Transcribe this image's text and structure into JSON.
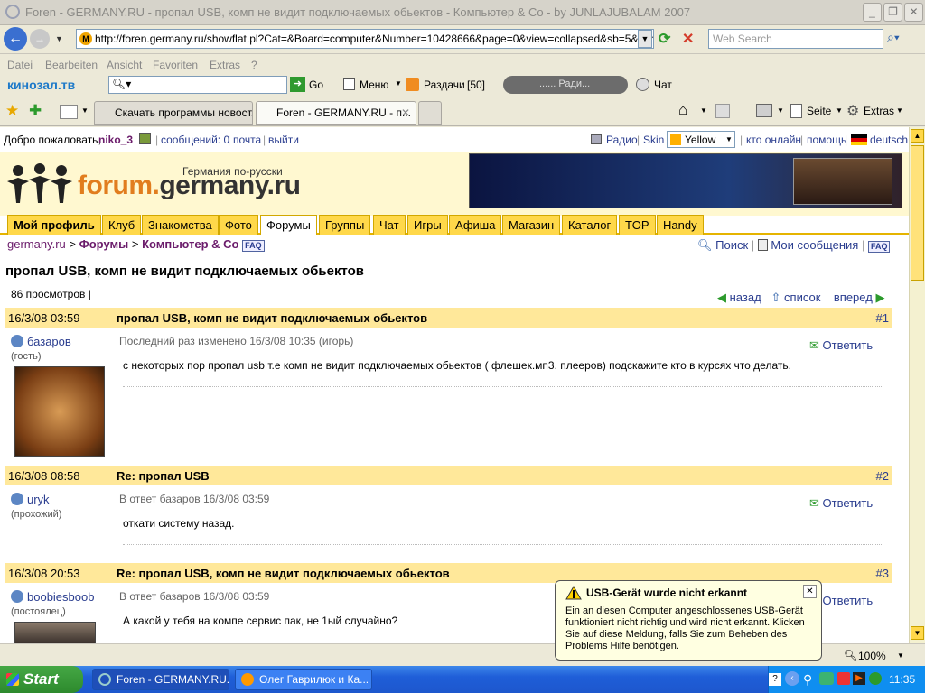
{
  "window": {
    "title": "Foren - GERMANY.RU - пропал USB, комп не видит подключаемых обьектов - Компьютер & Co - by JUNLAJUBALAM 2007"
  },
  "nav": {
    "address": "http://foren.germany.ru/showflat.pl?Cat=&Board=computer&Number=10428666&page=0&view=collapsed&sb=5&part=1&",
    "search_placeholder": "Web Search"
  },
  "menu": [
    "Datei",
    "Bearbeiten",
    "Ansicht",
    "Favoriten",
    "Extras",
    "?"
  ],
  "linkbar": {
    "brand": "кинозал.тв",
    "go": "Go",
    "menu": "Меню",
    "razdachi": "Раздачи",
    "razdachi_count": "[50]",
    "radio": "...... Ради...",
    "chat": "Чат"
  },
  "tabs": [
    {
      "label": "Скачать программы новост..."
    },
    {
      "label": "Foren - GERMANY.RU - п..."
    }
  ],
  "cmdbar": {
    "seite": "Seite",
    "extras": "Extras"
  },
  "userbar": {
    "welcome": "Добро пожаловать,",
    "username": "niko_3",
    "messages": "сообщений: 0",
    "mail": "почта",
    "logout": "выйти",
    "radio": "Радио",
    "skin": "Skin",
    "skin_value": "Yellow",
    "who_online": "кто онлайн",
    "help": "помощь",
    "lang": "deutsch"
  },
  "banner": {
    "logo_forum": "forum.",
    "logo_domain": "germany.ru",
    "tagline": "Германия по-русски"
  },
  "navtabs": [
    "Мой профиль",
    "Клуб",
    "Знакомства",
    "Фото",
    "Форумы",
    "Группы",
    "Чат",
    "Игры",
    "Афиша",
    "Магазин",
    "Каталог",
    "TOP",
    "Handy"
  ],
  "breadcrumb": {
    "site": "germany.ru",
    "forums": "Форумы",
    "board": "Компьютер & Co",
    "faq": "FAQ"
  },
  "toplinks": {
    "search": "Поиск",
    "my_messages": "Мои сообщения",
    "faq": "FAQ"
  },
  "topic": {
    "title": "пропал USB, комп не видит подключаемых обьектов",
    "views": "86 просмотров",
    "back": "назад",
    "list": "список",
    "forward": "вперед"
  },
  "posts": [
    {
      "date": "16/3/08 03:59",
      "subject": "пропал USB, комп не видит подключаемых обьектов",
      "num": "#1",
      "author": "базаров",
      "role": "(гость)",
      "meta": "Последний раз изменено 16/3/08 10:35 (игорь)",
      "reply": "Ответить",
      "body": "с некоторых пор пропал usb т.е комп не видит подключаемых обьектов ( флешек.мп3. плееров) подскажите кто в курсях что делать."
    },
    {
      "date": "16/3/08 08:58",
      "subject": "Re: пропал USB",
      "num": "#2",
      "author": "uryk",
      "role": "(прохожий)",
      "meta": "В ответ базаров 16/3/08 03:59",
      "reply": "Ответить",
      "body": "откати систему назад."
    },
    {
      "date": "16/3/08 20:53",
      "subject": "Re: пропал USB, комп не видит подключаемых обьектов",
      "num": "#3",
      "author": "boobiesboob",
      "role": "(постоялец)",
      "meta": "В ответ базаров 16/3/08 03:59",
      "reply": "Ответить",
      "body": "А какой у тебя на компе сервис пак, не 1ый случайно?"
    }
  ],
  "balloon": {
    "title": "USB-Gerät wurde nicht erkannt",
    "body": "Ein an diesen Computer angeschlossenes USB-Gerät funktioniert nicht richtig und wird nicht erkannt. Klicken Sie auf diese Meldung, falls Sie zum Beheben des Problems Hilfe benötigen."
  },
  "statusbar": {
    "zoom": "100%"
  },
  "taskbar": {
    "start": "Start",
    "tasks": [
      {
        "label": "Foren - GERMANY.RU...."
      },
      {
        "label": "Олег Гаврилюк и Ка..."
      }
    ],
    "clock": "11:35"
  },
  "colors": {
    "accent_yellow": "#ffd84a",
    "post_header": "#ffe89a",
    "link": "#2a3d8f",
    "logo_orange": "#e17d1e"
  }
}
